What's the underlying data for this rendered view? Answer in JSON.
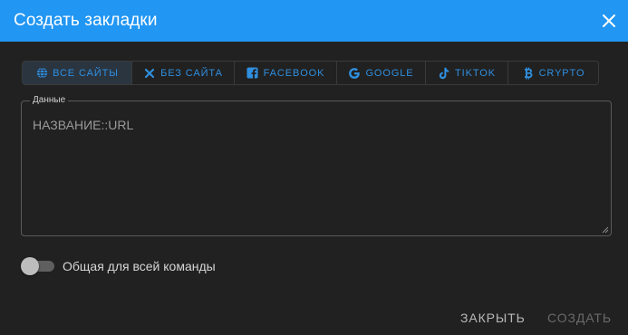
{
  "dialog": {
    "title": "Создать закладки",
    "close_icon": "close-icon"
  },
  "tabs": [
    {
      "label": "ВСЕ САЙТЫ",
      "icon": "globe-icon",
      "active": true
    },
    {
      "label": "БЕЗ САЙТА",
      "icon": "x-icon",
      "active": false
    },
    {
      "label": "FACEBOOK",
      "icon": "facebook-icon",
      "active": false
    },
    {
      "label": "GOOGLE",
      "icon": "google-icon",
      "active": false
    },
    {
      "label": "TIKTOK",
      "icon": "tiktok-icon",
      "active": false
    },
    {
      "label": "CRYPTO",
      "icon": "bitcoin-icon",
      "active": false
    }
  ],
  "data_field": {
    "legend": "Данные",
    "placeholder": "НАЗВАНИЕ::URL",
    "value": ""
  },
  "team_toggle": {
    "label": "Общая для всей команды",
    "checked": false
  },
  "actions": {
    "close_label": "ЗАКРЫТЬ",
    "create_label": "СОЗДАТЬ"
  },
  "colors": {
    "header": "#2196f3",
    "background": "#212121",
    "tab_accent": "#2f8fe0",
    "active_tab_bg": "#2a3540"
  }
}
